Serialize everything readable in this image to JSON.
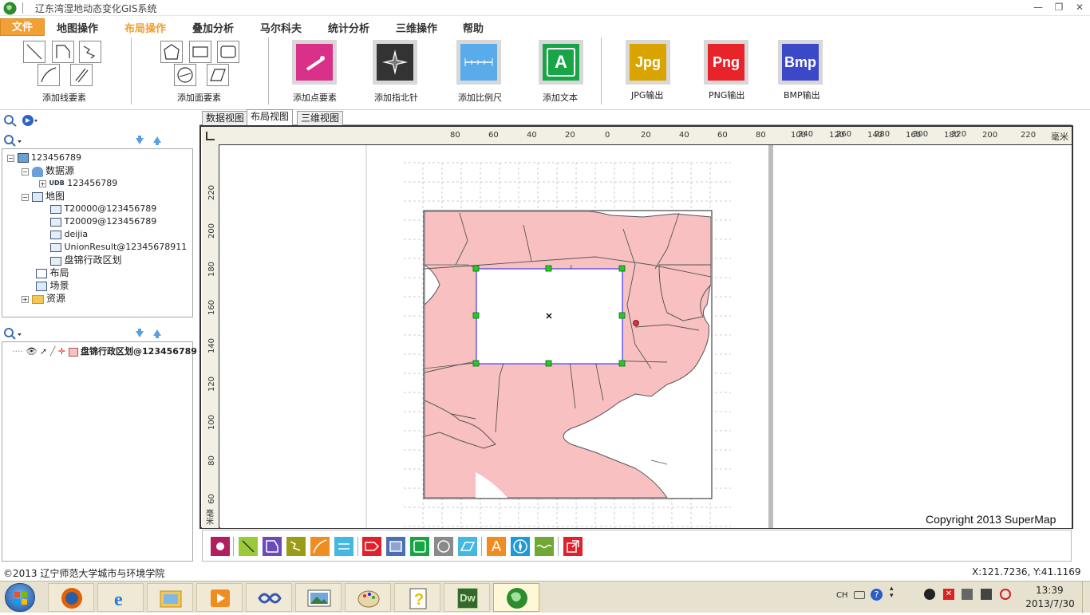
{
  "window": {
    "title": "辽东湾湿地动态变化GIS系统",
    "minimize_glyph": "—",
    "restore_glyph": "❐",
    "close_glyph": "✕"
  },
  "menu": {
    "file": "文件",
    "items": [
      "地图操作",
      "布局操作",
      "叠加分析",
      "马尔科夫",
      "统计分析",
      "三维操作",
      "帮助"
    ],
    "active": "布局操作"
  },
  "ribbon": {
    "add_line": "添加线要素",
    "add_polygon": "添加面要素",
    "add_point": "添加点要素",
    "add_north": "添加指北针",
    "add_scale": "添加比例尺",
    "add_text": "添加文本",
    "jpg": {
      "icon_text": "Jpg",
      "label": "JPG输出",
      "color": "#d9a300"
    },
    "png": {
      "icon_text": "Png",
      "label": "PNG输出",
      "color": "#e8232a"
    },
    "bmp": {
      "icon_text": "Bmp",
      "label": "BMP输出",
      "color": "#3b48c8"
    },
    "text_icon_letter": "A"
  },
  "workspace_tree": {
    "root": "123456789",
    "datasource_group": "数据源",
    "datasource": "123456789",
    "datasource_badge": "UDB",
    "map_group": "地图",
    "maps": [
      "T20000@123456789",
      "T20009@123456789",
      "deijia",
      "UnionResult@12345678911",
      "盘锦行政区划"
    ],
    "layout": "布局",
    "scene": "场景",
    "resources": "资源"
  },
  "layer_panel": {
    "layer": "盘锦行政区划@123456789"
  },
  "tabs": [
    "数据视图",
    "布局视图",
    "三维视图"
  ],
  "active_tab": "布局视图",
  "ruler": {
    "top_ticks": [
      "80",
      "60",
      "40",
      "20",
      "0",
      "20",
      "40",
      "60",
      "80",
      "100",
      "120",
      "140",
      "160",
      "180",
      "200",
      "220",
      "240",
      "260",
      "280",
      "300",
      "320"
    ],
    "unit": "毫米",
    "left_ticks": [
      "220",
      "200",
      "180",
      "160",
      "140",
      "120",
      "100",
      "80",
      "60"
    ],
    "left_unit": "毫米"
  },
  "copyright": "Copyright 2013 SuperMap",
  "status": {
    "left": "©2013 辽宁师范大学城市与环境学院",
    "coords": "X:121.7236,  Y:41.1169"
  },
  "taskbar": {
    "lang": "CH",
    "time": "13:39",
    "date": "2013/7/30",
    "dw_label": "Dw"
  },
  "colors": {
    "accent": "#f0a035",
    "menu_active": "#f0a035",
    "map_fill": "#f8c0c0",
    "map_stroke": "#555555",
    "handle": "#22cc22",
    "selection": "#1a1aff"
  }
}
